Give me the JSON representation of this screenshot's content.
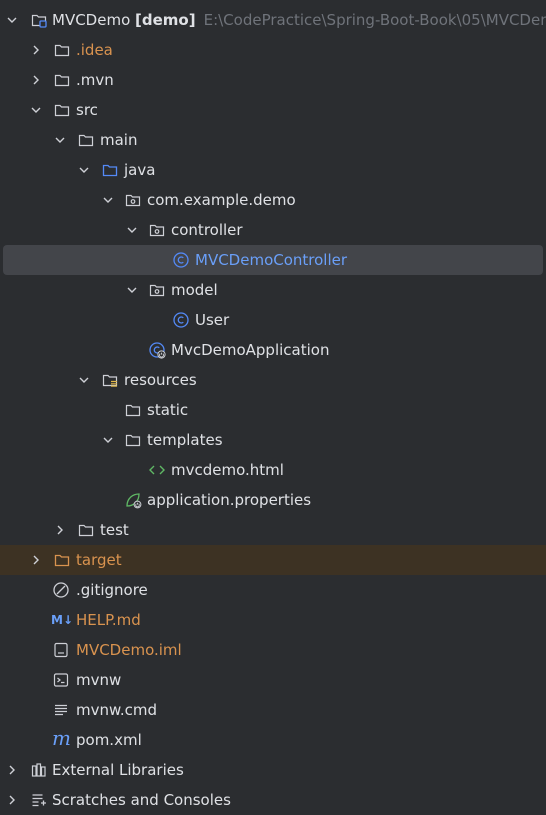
{
  "tree": {
    "root": {
      "name": "MVCDemo",
      "module": "[demo]",
      "path": "E:\\CodePractice\\Spring-Boot-Book\\05\\MVCDemo"
    },
    "idea": ".idea",
    "mvn": ".mvn",
    "src": "src",
    "main": "main",
    "java": "java",
    "package": "com.example.demo",
    "controller": "controller",
    "controller_class": "MVCDemoController",
    "model": "model",
    "user_class": "User",
    "app_class": "MvcDemoApplication",
    "resources": "resources",
    "static": "static",
    "templates": "templates",
    "html_file": "mvcdemo.html",
    "props_file": "application.properties",
    "test": "test",
    "target": "target",
    "gitignore": ".gitignore",
    "help": "HELP.md",
    "iml": "MVCDemo.iml",
    "mvnw": "mvnw",
    "mvnw_cmd": "mvnw.cmd",
    "pom": "pom.xml",
    "external_libraries": "External Libraries",
    "scratches": "Scratches and Consoles",
    "md_badge": "M↓"
  },
  "colors": {
    "background": "#2b2d30",
    "selection": "#43454a",
    "excluded_row": "#3d3223",
    "ignored_text": "#d9934f",
    "class_icon": "#548af7",
    "path_text": "#6f737a"
  }
}
